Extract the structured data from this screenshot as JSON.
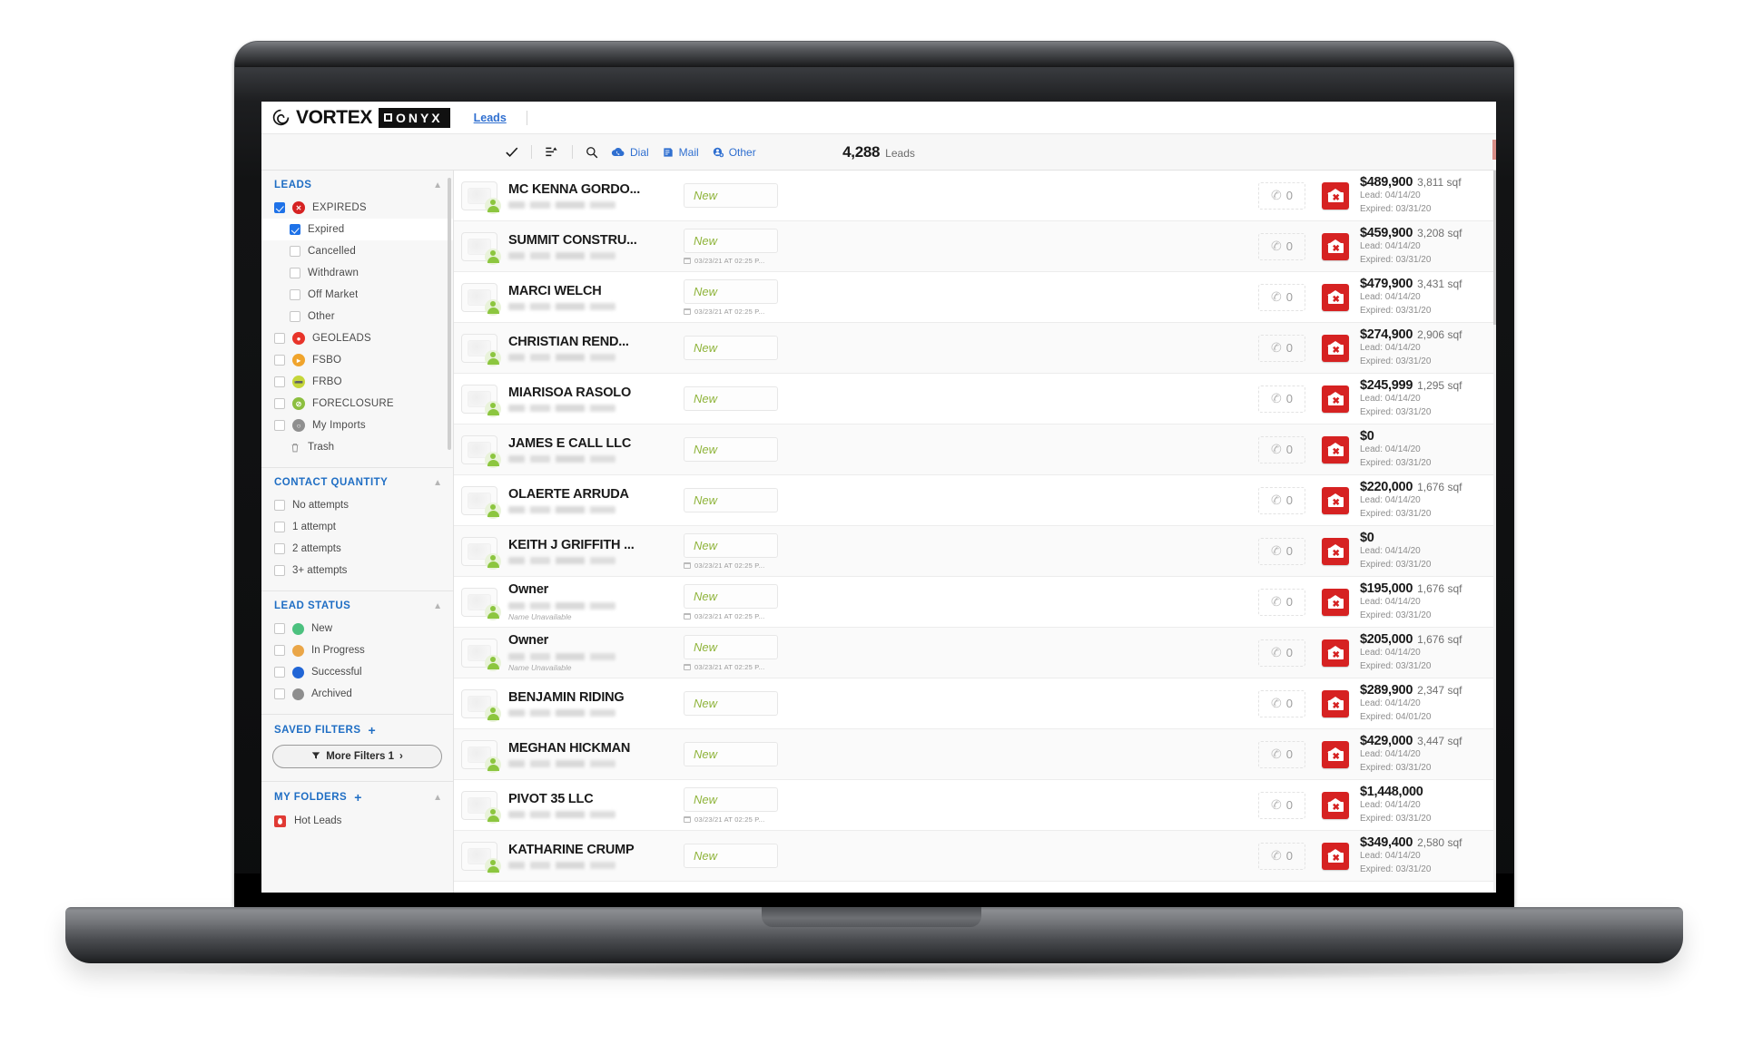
{
  "app": {
    "brand_word": "VORTEX",
    "brand_suffix": "ONYX",
    "nav_link": "Leads"
  },
  "toolbar": {
    "check_icon": "checkmark-icon",
    "filter_icon": "filter-sort-icon",
    "search_icon": "search-icon",
    "actions": [
      {
        "label": "Dial",
        "icon": "dial-cloud-icon"
      },
      {
        "label": "Mail",
        "icon": "mail-icon"
      },
      {
        "label": "Other",
        "icon": "other-circle-icon"
      }
    ],
    "count_value": "4,288",
    "count_label": "Leads"
  },
  "sidebar": {
    "leads": {
      "title": "LEADS",
      "items": [
        {
          "label": "EXPIREDS",
          "checked": true,
          "indent": false,
          "selected": false,
          "badge": "#d62222",
          "badge_glyph": "✕"
        },
        {
          "label": "Expired",
          "checked": true,
          "indent": true,
          "selected": true,
          "badge": null,
          "badge_glyph": ""
        },
        {
          "label": "Cancelled",
          "checked": false,
          "indent": true,
          "selected": false,
          "badge": null,
          "badge_glyph": ""
        },
        {
          "label": "Withdrawn",
          "checked": false,
          "indent": true,
          "selected": false,
          "badge": null,
          "badge_glyph": ""
        },
        {
          "label": "Off Market",
          "checked": false,
          "indent": true,
          "selected": false,
          "badge": null,
          "badge_glyph": ""
        },
        {
          "label": "Other",
          "checked": false,
          "indent": true,
          "selected": false,
          "badge": null,
          "badge_glyph": ""
        },
        {
          "label": "GEOLEADS",
          "checked": false,
          "indent": false,
          "selected": false,
          "badge": "#e8342a",
          "badge_glyph": "●"
        },
        {
          "label": "FSBO",
          "checked": false,
          "indent": false,
          "selected": false,
          "badge": "#f0a42c",
          "badge_glyph": "▸"
        },
        {
          "label": "FRBO",
          "checked": false,
          "indent": false,
          "selected": false,
          "badge": "#c5d63a",
          "badge_glyph": "➖"
        },
        {
          "label": "FORECLOSURE",
          "checked": false,
          "indent": false,
          "selected": false,
          "badge": "#8cbf3f",
          "badge_glyph": "⊘"
        },
        {
          "label": "My Imports",
          "checked": false,
          "indent": false,
          "selected": false,
          "badge": "#8f8f8f",
          "badge_glyph": "○"
        }
      ],
      "trash_label": "Trash",
      "trash_icon": "trash-icon"
    },
    "contact_quantity": {
      "title": "CONTACT QUANTITY",
      "items": [
        {
          "label": "No attempts",
          "checked": false
        },
        {
          "label": "1 attempt",
          "checked": false
        },
        {
          "label": "2 attempts",
          "checked": false
        },
        {
          "label": "3+ attempts",
          "checked": false
        }
      ]
    },
    "lead_status": {
      "title": "LEAD STATUS",
      "items": [
        {
          "label": "New",
          "checked": false,
          "color": "#4cc17f"
        },
        {
          "label": "In Progress",
          "checked": false,
          "color": "#eaa648"
        },
        {
          "label": "Successful",
          "checked": false,
          "color": "#2166d6"
        },
        {
          "label": "Archived",
          "checked": false,
          "color": "#8e8e8e"
        }
      ]
    },
    "saved_filters": {
      "title": "SAVED FILTERS",
      "add": "+",
      "more_filters_label": "More Filters 1",
      "more_filters_chevron": "›",
      "filter_icon": "funnel-icon"
    },
    "my_folders": {
      "title": "MY FOLDERS",
      "add": "+",
      "items": [
        {
          "label": "Hot Leads",
          "icon": "hot-leads-flame-icon"
        }
      ]
    }
  },
  "list": {
    "status_placeholder": "New",
    "phone_count": "0",
    "appointment_text": "03/23/21 AT 02:25 P...",
    "name_unavailable": "Name Unavailable",
    "rows": [
      {
        "name": "MC KENNA GORDO...",
        "mixed": false,
        "status": "New",
        "appt": false,
        "unavailable": false,
        "price": "$489,900",
        "sqf": "3,811 sqf",
        "lead": "Lead: 04/14/20",
        "expired": "Expired: 03/31/20"
      },
      {
        "name": "SUMMIT CONSTRU...",
        "mixed": false,
        "status": "New",
        "appt": true,
        "unavailable": false,
        "price": "$459,900",
        "sqf": "3,208 sqf",
        "lead": "Lead: 04/14/20",
        "expired": "Expired: 03/31/20"
      },
      {
        "name": "MARCI WELCH",
        "mixed": false,
        "status": "New",
        "appt": true,
        "unavailable": false,
        "price": "$479,900",
        "sqf": "3,431 sqf",
        "lead": "Lead: 04/14/20",
        "expired": "Expired: 03/31/20"
      },
      {
        "name": "CHRISTIAN REND...",
        "mixed": false,
        "status": "New",
        "appt": false,
        "unavailable": false,
        "price": "$274,900",
        "sqf": "2,906 sqf",
        "lead": "Lead: 04/14/20",
        "expired": "Expired: 03/31/20"
      },
      {
        "name": "MIARISOA RASOLO",
        "mixed": false,
        "status": "New",
        "appt": false,
        "unavailable": false,
        "price": "$245,999",
        "sqf": "1,295 sqf",
        "lead": "Lead: 04/14/20",
        "expired": "Expired: 03/31/20"
      },
      {
        "name": "JAMES E CALL LLC",
        "mixed": false,
        "status": "New",
        "appt": false,
        "unavailable": false,
        "price": "$0",
        "sqf": "",
        "lead": "Lead: 04/14/20",
        "expired": "Expired: 03/31/20"
      },
      {
        "name": "OLAERTE ARRUDA",
        "mixed": false,
        "status": "New",
        "appt": false,
        "unavailable": false,
        "price": "$220,000",
        "sqf": "1,676 sqf",
        "lead": "Lead: 04/14/20",
        "expired": "Expired: 03/31/20"
      },
      {
        "name": "KEITH J GRIFFITH ...",
        "mixed": false,
        "status": "New",
        "appt": true,
        "unavailable": false,
        "price": "$0",
        "sqf": "",
        "lead": "Lead: 04/14/20",
        "expired": "Expired: 03/31/20"
      },
      {
        "name": "Owner",
        "mixed": true,
        "status": "New",
        "appt": true,
        "unavailable": true,
        "price": "$195,000",
        "sqf": "1,676 sqf",
        "lead": "Lead: 04/14/20",
        "expired": "Expired: 03/31/20"
      },
      {
        "name": "Owner",
        "mixed": true,
        "status": "New",
        "appt": true,
        "unavailable": true,
        "price": "$205,000",
        "sqf": "1,676 sqf",
        "lead": "Lead: 04/14/20",
        "expired": "Expired: 03/31/20"
      },
      {
        "name": "BENJAMIN RIDING",
        "mixed": false,
        "status": "New",
        "appt": false,
        "unavailable": false,
        "price": "$289,900",
        "sqf": "2,347 sqf",
        "lead": "Lead: 04/14/20",
        "expired": "Expired: 04/01/20"
      },
      {
        "name": "MEGHAN HICKMAN",
        "mixed": false,
        "status": "New",
        "appt": false,
        "unavailable": false,
        "price": "$429,000",
        "sqf": "3,447 sqf",
        "lead": "Lead: 04/14/20",
        "expired": "Expired: 03/31/20"
      },
      {
        "name": "PIVOT 35 LLC",
        "mixed": false,
        "status": "New",
        "appt": true,
        "unavailable": false,
        "price": "$1,448,000",
        "sqf": "",
        "lead": "Lead: 04/14/20",
        "expired": "Expired: 03/31/20"
      },
      {
        "name": "KATHARINE CRUMP",
        "mixed": false,
        "status": "New",
        "appt": false,
        "unavailable": false,
        "price": "$349,400",
        "sqf": "2,580 sqf",
        "lead": "Lead: 04/14/20",
        "expired": "Expired: 03/31/20"
      }
    ]
  }
}
